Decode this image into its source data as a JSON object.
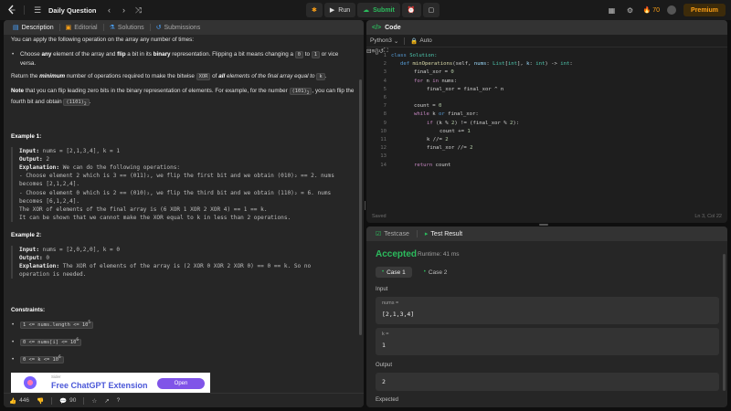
{
  "topnav": {
    "title": "Daily Question",
    "run_label": "Run",
    "submit_label": "Submit",
    "streak_count": "70",
    "premium_label": "Premium"
  },
  "tabs": [
    {
      "label": "Description",
      "icon": "description-icon"
    },
    {
      "label": "Editorial",
      "icon": "editorial-icon"
    },
    {
      "label": "Solutions",
      "icon": "solutions-icon"
    },
    {
      "label": "Submissions",
      "icon": "submissions-icon"
    }
  ],
  "description": {
    "intro": "You can apply the following operation on the array any number of times:",
    "bullet1_a": "Choose ",
    "bullet1_b": "any",
    "bullet1_c": " element of the array and ",
    "bullet1_d": "flip",
    "bullet1_e": " a bit in its ",
    "bullet1_f": "binary",
    "bullet1_g": " representation. Flipping a bit means changing a ",
    "bullet1_zero": "0",
    "bullet1_h": " to ",
    "bullet1_one": "1",
    "bullet1_i": " or vice versa.",
    "ret_a": "Return the ",
    "ret_b": "minimum",
    "ret_c": " number of operations required to make the bitwise ",
    "ret_xor": "XOR",
    "ret_d": " of ",
    "ret_e": "all",
    "ret_f": " elements of the final array equal to ",
    "ret_k": "k",
    "ret_g": ".",
    "note_a": "Note",
    "note_b": " that you can flip leading zero bits in the binary representation of elements. For example, for the number ",
    "note_c1": "(101)",
    "note_sub2": "2",
    "note_c": ", you can flip the fourth bit and obtain ",
    "note_d1": "(1101)",
    "note_sub2b": "2",
    "note_e": "."
  },
  "example1": {
    "title": "Example 1:",
    "input_label": "Input:",
    "input_val": " nums = [2,1,3,4], k = 1",
    "output_label": "Output:",
    "output_val": " 2",
    "expl_label": "Explanation:",
    "expl_val": " We can do the following operations:",
    "line1": "- Choose element 2 which is 3 == (011)₂, we flip the first bit and we obtain (010)₂ == 2. nums",
    "line2": "becomes [2,1,2,4].",
    "line3": "- Choose element 0 which is 2 == (010)₂, we flip the third bit and we obtain (110)₂ = 6. nums",
    "line4": "becomes [6,1,2,4].",
    "line5": "The XOR of elements of the final array is (6 XOR 1 XOR 2 XOR 4) == 1 == k.",
    "line6": "It can be shown that we cannot make the XOR equal to k in less than 2 operations."
  },
  "example2": {
    "title": "Example 2:",
    "input_label": "Input:",
    "input_val": " nums = [2,0,2,0], k = 0",
    "output_label": "Output:",
    "output_val": " 0",
    "expl_label": "Explanation:",
    "expl_val": " The XOR of elements of the array is (2 XOR 0 XOR 2 XOR 0) == 0 == k. So no",
    "line2": "operation is needed."
  },
  "constraints": {
    "title": "Constraints:",
    "items": [
      {
        "base": "1 <= nums.length <= 10",
        "sup": "5"
      },
      {
        "base": "0 <= nums[i] <= 10",
        "sup": "6"
      },
      {
        "base": "0 <= k <= 10",
        "sup": "6"
      }
    ]
  },
  "ad": {
    "sub": "Sider",
    "title": "Free ChatGPT Extension",
    "button": "Open"
  },
  "left_footer": {
    "likes": "446",
    "comments": "90"
  },
  "code_panel": {
    "title": "Code",
    "language": "Python3",
    "mode": "Auto",
    "status_left": "Saved",
    "status_right": "Ln 3, Col 22"
  },
  "code_lines": [
    {
      "n": "1"
    },
    {
      "n": "2"
    },
    {
      "n": "3"
    },
    {
      "n": "4"
    },
    {
      "n": "5"
    },
    {
      "n": "6"
    },
    {
      "n": "7"
    },
    {
      "n": "8"
    },
    {
      "n": "9"
    },
    {
      "n": "10"
    },
    {
      "n": "11"
    },
    {
      "n": "12"
    },
    {
      "n": "13"
    },
    {
      "n": "14"
    }
  ],
  "code": {
    "l1_kw": "class",
    "l1_name": " Solution:",
    "l2_kw": "def",
    "l2_fn": " minOperations",
    "l2_a": "(self, ",
    "l2_nums": "nums",
    "l2_b": ": ",
    "l2_list": "List",
    "l2_c": "[",
    "l2_int1": "int",
    "l2_d": "], ",
    "l2_k": "k",
    "l2_e": ": ",
    "l2_int2": "int",
    "l2_f": ") -> ",
    "l2_int3": "int",
    "l2_g": ":",
    "l3_a": "final_xor = ",
    "l3_num": "0",
    "l4_kw": "for",
    "l4_a": " n ",
    "l4_kw2": "in",
    "l4_b": " nums:",
    "l5_a": "final_xor = final_xor ^ n",
    "l7_a": "count = ",
    "l7_num": "0",
    "l8_kw": "while",
    "l8_a": " k ",
    "l8_kw2": "or",
    "l8_b": " final_xor:",
    "l9_kw": "if",
    "l9_a": " (k % ",
    "l9_n1": "2",
    "l9_b": ") != (final_xor % ",
    "l9_n2": "2",
    "l9_c": "):",
    "l10_a": "count += ",
    "l10_num": "1",
    "l11_a": "k //= ",
    "l11_num": "2",
    "l12_a": "final_xor //= ",
    "l12_num": "2",
    "l14_kw": "return",
    "l14_a": " count"
  },
  "result": {
    "tab_testcase": "Testcase",
    "tab_result": "Test Result",
    "status": "Accepted",
    "runtime": "Runtime: 41 ms",
    "case1": "Case 1",
    "case2": "Case 2",
    "input_label": "Input",
    "var1_name": "nums =",
    "var1_value": "[2,1,3,4]",
    "var2_name": "k =",
    "var2_value": "1",
    "output_label": "Output",
    "output_value": "2",
    "expected_label": "Expected"
  },
  "colors": {
    "accent_green": "#2cbb5d",
    "accent_orange": "#ffa116",
    "background": "#0f0f0f",
    "panel": "#262626"
  }
}
